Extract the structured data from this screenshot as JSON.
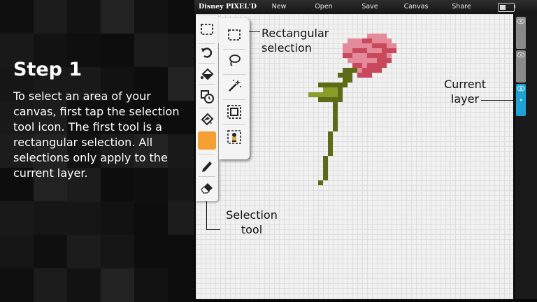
{
  "tutorial": {
    "title": "Step 1",
    "body": "To select an area of your canvas, first tap the selection tool icon. The first tool is a rectangular selection. All selections only apply to the current layer."
  },
  "menubar": {
    "logo": "Disney PIXEL'D",
    "items": [
      "New",
      "Open",
      "Save",
      "Canvas",
      "Share"
    ]
  },
  "toolbar": {
    "tools": [
      "selection-tool-icon",
      "undo-icon",
      "fill-icon",
      "history-icon",
      "eyedropper-icon",
      "color-swatch",
      "pencil-icon",
      "eraser-icon"
    ],
    "active_color": "#f5a033"
  },
  "selection_tools": [
    "rectangular-selection-icon",
    "lasso-selection-icon",
    "magic-wand-icon",
    "select-all-icon",
    "selection-character-icon"
  ],
  "callouts": {
    "rect_line1": "Rectangular",
    "rect_line2": "selection",
    "layer_line1": "Current",
    "layer_line2": "layer",
    "sel_line1": "Selection",
    "sel_line2": "tool"
  },
  "layers": {
    "count": 3,
    "active_index": 2,
    "active_color": "#1fa3d6"
  },
  "colors": {
    "rose_light": "#e58a98",
    "rose_dark": "#c8485c",
    "stem": "#5e6b16",
    "leaf_light": "#8a9d2a"
  }
}
